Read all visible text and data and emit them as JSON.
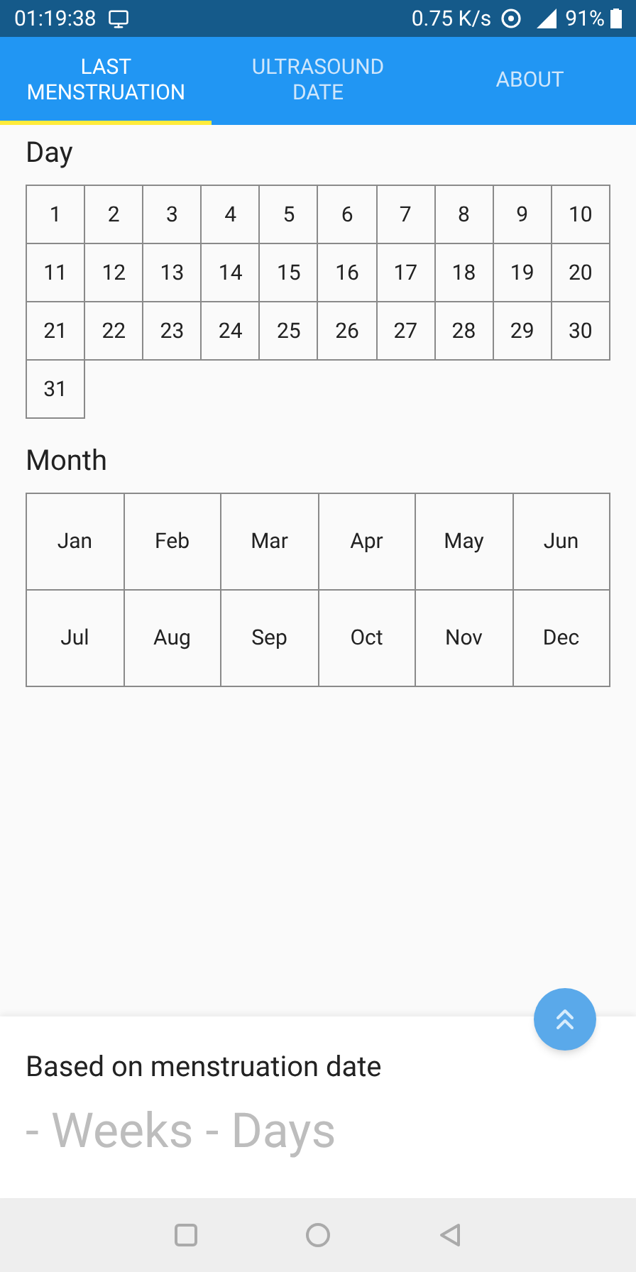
{
  "status_bar": {
    "time": "01:19:38",
    "speed": "0.75 K/s",
    "battery": "91%"
  },
  "tabs": [
    {
      "label": "LAST MENSTRUATION",
      "selected": true
    },
    {
      "label": "ULTRASOUND DATE",
      "selected": false
    },
    {
      "label": "ABOUT",
      "selected": false
    }
  ],
  "day_section": {
    "title": "Day",
    "days": [
      "1",
      "2",
      "3",
      "4",
      "5",
      "6",
      "7",
      "8",
      "9",
      "10",
      "11",
      "12",
      "13",
      "14",
      "15",
      "16",
      "17",
      "18",
      "19",
      "20",
      "21",
      "22",
      "23",
      "24",
      "25",
      "26",
      "27",
      "28",
      "29",
      "30",
      "31"
    ]
  },
  "month_section": {
    "title": "Month",
    "months": [
      "Jan",
      "Feb",
      "Mar",
      "Apr",
      "May",
      "Jun",
      "Jul",
      "Aug",
      "Sep",
      "Oct",
      "Nov",
      "Dec"
    ]
  },
  "result": {
    "title": "Based on menstruation date",
    "value": "- Weeks - Days"
  }
}
